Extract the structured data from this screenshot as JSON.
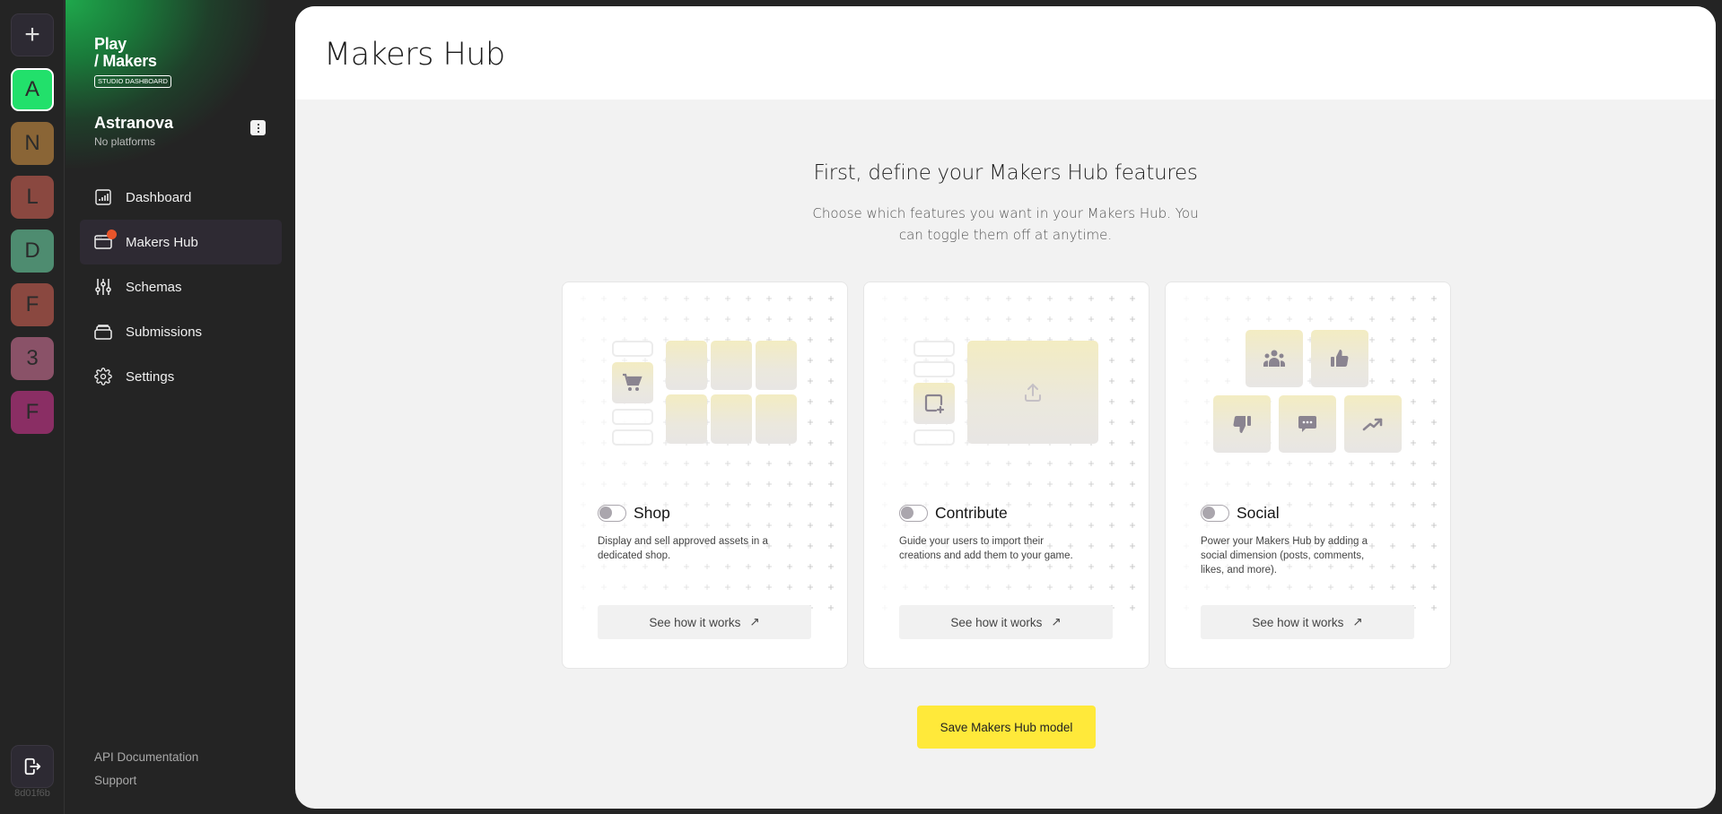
{
  "rail": {
    "add_icon": "plus-icon",
    "studios": [
      {
        "letter": "A",
        "color": "#22e06b",
        "active": true
      },
      {
        "letter": "N",
        "color": "#8a6536"
      },
      {
        "letter": "L",
        "color": "#8a4840"
      },
      {
        "letter": "D",
        "color": "#4e8c70"
      },
      {
        "letter": "F",
        "color": "#8a4840"
      },
      {
        "letter": "3",
        "color": "#8a5268"
      },
      {
        "letter": "F",
        "color": "#8a2e64"
      }
    ],
    "logout_icon": "logout-icon",
    "build_hash": "8d01f6b"
  },
  "sidebar": {
    "logo_line1": "Play",
    "logo_line2": "/ Makers",
    "logo_badge": "STUDIO DASHBOARD",
    "studio_name": "Astranova",
    "studio_sub": "No platforms",
    "nav": [
      {
        "label": "Dashboard",
        "icon": "bar-chart-icon"
      },
      {
        "label": "Makers Hub",
        "icon": "browser-window-icon",
        "active": true,
        "badge": "alert"
      },
      {
        "label": "Schemas",
        "icon": "sliders-icon"
      },
      {
        "label": "Submissions",
        "icon": "stack-icon"
      },
      {
        "label": "Settings",
        "icon": "gear-icon"
      }
    ],
    "footer": {
      "api_docs": "API Documentation",
      "support": "Support"
    }
  },
  "main": {
    "title": "Makers Hub",
    "heading": "First, define your Makers Hub features",
    "subheading": "Choose which features you want in your Makers Hub. You can toggle them off at anytime.",
    "cards": [
      {
        "title": "Shop",
        "description": "Display and sell approved assets in a dedicated shop.",
        "enabled": false,
        "button": "See how it works",
        "button_icon": "external-arrow-icon"
      },
      {
        "title": "Contribute",
        "description": "Guide your users to import their creations and add them to your game.",
        "enabled": false,
        "button": "See how it works",
        "button_icon": "external-arrow-icon"
      },
      {
        "title": "Social",
        "description": "Power your Makers Hub by adding a social dimension (posts, comments, likes, and more).",
        "enabled": false,
        "button": "See how it works",
        "button_icon": "external-arrow-icon"
      }
    ],
    "save_button": "Save Makers Hub model"
  },
  "colors": {
    "accent_yellow": "#ffe93a",
    "brand_green": "#22e06b",
    "alert_badge": "#e8542a"
  }
}
